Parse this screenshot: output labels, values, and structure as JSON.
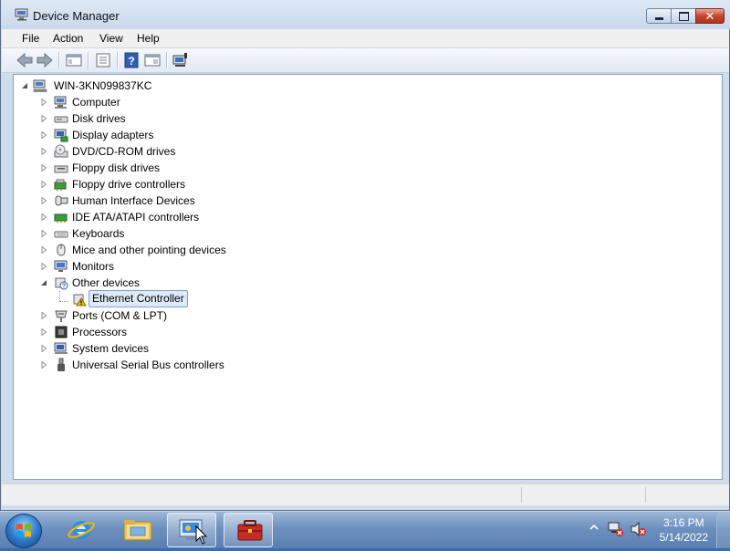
{
  "window": {
    "title": "Device Manager"
  },
  "menu": {
    "items": [
      "File",
      "Action",
      "View",
      "Help"
    ]
  },
  "tree": {
    "root": "WIN-3KN099837KC",
    "categories": [
      {
        "label": "Computer",
        "icon": "computer-icon"
      },
      {
        "label": "Disk drives",
        "icon": "disk-drive-icon"
      },
      {
        "label": "Display adapters",
        "icon": "display-adapter-icon"
      },
      {
        "label": "DVD/CD-ROM drives",
        "icon": "dvd-drive-icon"
      },
      {
        "label": "Floppy disk drives",
        "icon": "floppy-drive-icon"
      },
      {
        "label": "Floppy drive controllers",
        "icon": "floppy-controller-icon"
      },
      {
        "label": "Human Interface Devices",
        "icon": "hid-icon"
      },
      {
        "label": "IDE ATA/ATAPI controllers",
        "icon": "ide-controller-icon"
      },
      {
        "label": "Keyboards",
        "icon": "keyboard-icon"
      },
      {
        "label": "Mice and other pointing devices",
        "icon": "mouse-icon"
      },
      {
        "label": "Monitors",
        "icon": "monitor-icon"
      },
      {
        "label": "Other devices",
        "icon": "unknown-device-icon",
        "expanded": true
      },
      {
        "label": "Ethernet Controller",
        "icon": "warning-device-icon",
        "child": true,
        "selected": true
      },
      {
        "label": "Ports (COM & LPT)",
        "icon": "port-icon"
      },
      {
        "label": "Processors",
        "icon": "processor-icon"
      },
      {
        "label": "System devices",
        "icon": "system-device-icon"
      },
      {
        "label": "Universal Serial Bus controllers",
        "icon": "usb-icon"
      }
    ]
  },
  "taskbar": {
    "time": "3:16 PM",
    "date": "5/14/2022"
  }
}
